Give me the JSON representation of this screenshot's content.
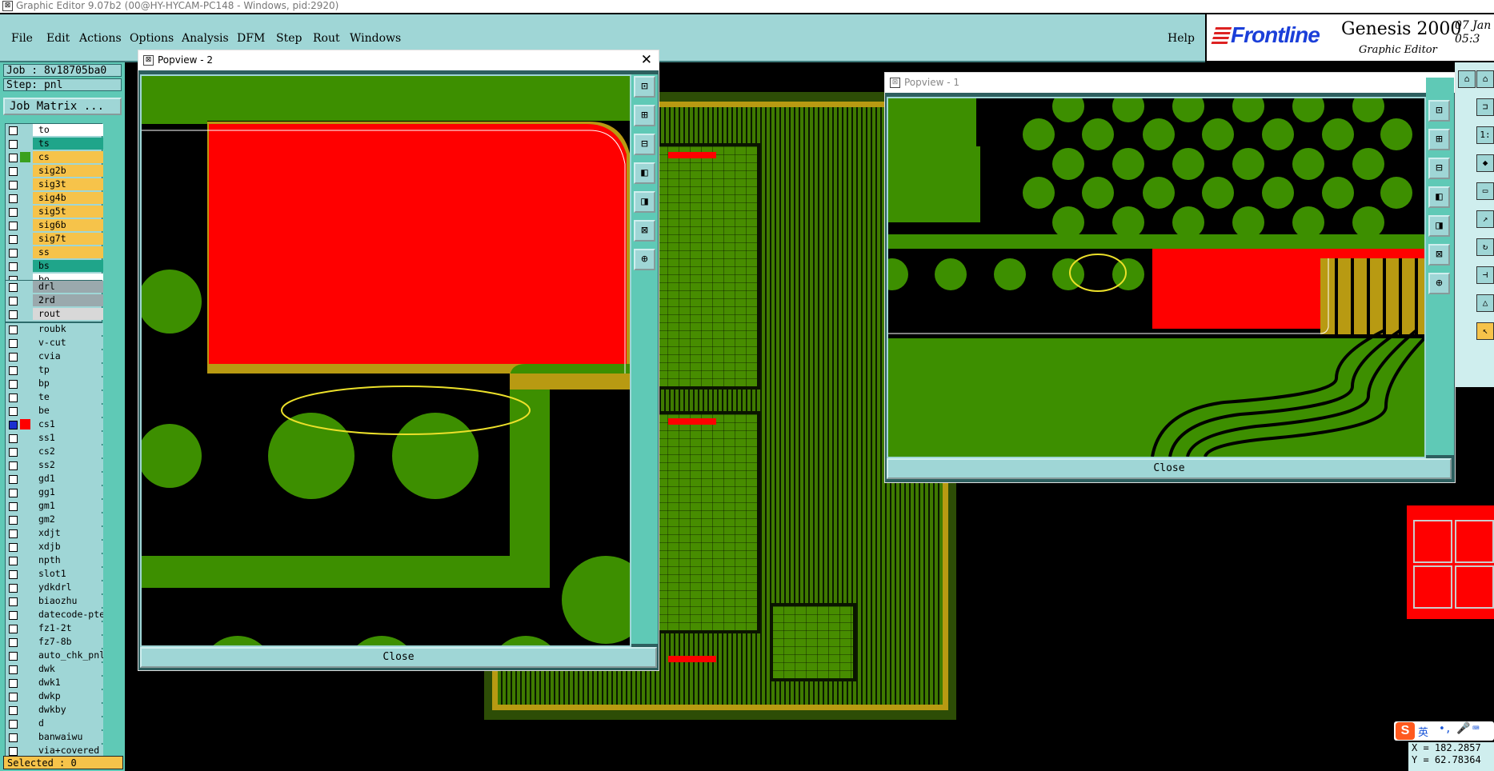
{
  "window": {
    "title": "Graphic Editor 9.07b2 (00@HY-HYCAM-PC148 - Windows, pid:2920)"
  },
  "menu": {
    "items": [
      "File",
      "Edit",
      "Actions",
      "Options",
      "Analysis",
      "DFM",
      "Step",
      "Rout",
      "Windows"
    ],
    "help": "Help"
  },
  "brand": {
    "logo_text": "Frontline",
    "product": "Genesis 2000",
    "subtitle": "Graphic Editor",
    "date_line1": "07 Jan",
    "date_line2": "05:3"
  },
  "job": {
    "job_line": "Job : 8v18705ba0",
    "step_line": "Step: pnl",
    "matrix_button": "Job Matrix ..."
  },
  "layers": {
    "group1": [
      {
        "name": "to",
        "color": "#ffffff",
        "swatch": "#9fd6d6"
      },
      {
        "name": "ts",
        "color": "#1fa58a",
        "swatch": "#9fd6d6"
      },
      {
        "name": "cs",
        "color": "#f6c34a",
        "swatch": "#3aa01e"
      },
      {
        "name": "sig2b",
        "color": "#f6c34a",
        "swatch": "#9fd6d6"
      },
      {
        "name": "sig3t",
        "color": "#f6c34a",
        "swatch": "#9fd6d6"
      },
      {
        "name": "sig4b",
        "color": "#f6c34a",
        "swatch": "#9fd6d6"
      },
      {
        "name": "sig5t",
        "color": "#f6c34a",
        "swatch": "#9fd6d6"
      },
      {
        "name": "sig6b",
        "color": "#f6c34a",
        "swatch": "#9fd6d6"
      },
      {
        "name": "sig7t",
        "color": "#f6c34a",
        "swatch": "#9fd6d6"
      },
      {
        "name": "ss",
        "color": "#f6c34a",
        "swatch": "#9fd6d6"
      },
      {
        "name": "bs",
        "color": "#1fa58a",
        "swatch": "#9fd6d6"
      },
      {
        "name": "bo",
        "color": "#ffffff",
        "swatch": "#9fd6d6"
      }
    ],
    "group2": [
      {
        "name": "drl",
        "color": "#9aa9ad",
        "swatch": "#9fd6d6"
      },
      {
        "name": "2rd",
        "color": "#9aa9ad",
        "swatch": "#9fd6d6"
      },
      {
        "name": "rout",
        "color": "#d8d8d8",
        "swatch": "#9fd6d6"
      }
    ],
    "group3": [
      {
        "name": "roubk",
        "color": "#9fd6d6",
        "swatch": "#9fd6d6"
      },
      {
        "name": "v-cut",
        "color": "#9fd6d6",
        "swatch": "#9fd6d6"
      },
      {
        "name": "cvia",
        "color": "#9fd6d6",
        "swatch": "#9fd6d6"
      },
      {
        "name": "tp",
        "color": "#9fd6d6",
        "swatch": "#9fd6d6"
      },
      {
        "name": "bp",
        "color": "#9fd6d6",
        "swatch": "#9fd6d6"
      },
      {
        "name": "te",
        "color": "#9fd6d6",
        "swatch": "#9fd6d6"
      },
      {
        "name": "be",
        "color": "#9fd6d6",
        "swatch": "#9fd6d6"
      },
      {
        "name": "cs1",
        "color": "#9fd6d6",
        "swatch": "#ff0000",
        "checkbox": "#1b2fd0"
      },
      {
        "name": "ss1",
        "color": "#9fd6d6",
        "swatch": "#9fd6d6"
      },
      {
        "name": "cs2",
        "color": "#9fd6d6",
        "swatch": "#9fd6d6"
      },
      {
        "name": "ss2",
        "color": "#9fd6d6",
        "swatch": "#9fd6d6"
      },
      {
        "name": "gd1",
        "color": "#9fd6d6",
        "swatch": "#9fd6d6"
      },
      {
        "name": "gg1",
        "color": "#9fd6d6",
        "swatch": "#9fd6d6"
      },
      {
        "name": "gm1",
        "color": "#9fd6d6",
        "swatch": "#9fd6d6"
      },
      {
        "name": "gm2",
        "color": "#9fd6d6",
        "swatch": "#9fd6d6"
      },
      {
        "name": "xdjt",
        "color": "#9fd6d6",
        "swatch": "#9fd6d6"
      },
      {
        "name": "xdjb",
        "color": "#9fd6d6",
        "swatch": "#9fd6d6"
      },
      {
        "name": "npth",
        "color": "#9fd6d6",
        "swatch": "#9fd6d6"
      },
      {
        "name": "slot1",
        "color": "#9fd6d6",
        "swatch": "#9fd6d6"
      },
      {
        "name": "ydkdrl",
        "color": "#9fd6d6",
        "swatch": "#9fd6d6"
      },
      {
        "name": "biaozhu",
        "color": "#9fd6d6",
        "swatch": "#9fd6d6"
      },
      {
        "name": "datecode-pte",
        "color": "#9fd6d6",
        "swatch": "#9fd6d6"
      },
      {
        "name": "fz1-2t",
        "color": "#9fd6d6",
        "swatch": "#9fd6d6"
      },
      {
        "name": "fz7-8b",
        "color": "#9fd6d6",
        "swatch": "#9fd6d6"
      },
      {
        "name": "auto_chk_pnl",
        "color": "#9fd6d6",
        "swatch": "#9fd6d6"
      },
      {
        "name": "dwk",
        "color": "#9fd6d6",
        "swatch": "#9fd6d6"
      },
      {
        "name": "dwk1",
        "color": "#9fd6d6",
        "swatch": "#9fd6d6"
      },
      {
        "name": "dwkp",
        "color": "#9fd6d6",
        "swatch": "#9fd6d6"
      },
      {
        "name": "dwkby",
        "color": "#9fd6d6",
        "swatch": "#9fd6d6"
      },
      {
        "name": "d",
        "color": "#9fd6d6",
        "swatch": "#9fd6d6"
      },
      {
        "name": "banwaiwu",
        "color": "#9fd6d6",
        "swatch": "#9fd6d6"
      },
      {
        "name": "via+covered",
        "color": "#9fd6d6",
        "swatch": "#9fd6d6"
      }
    ]
  },
  "status": {
    "selected": "Selected : 0"
  },
  "popview2": {
    "title": "Popview - 2",
    "close_label": "Close"
  },
  "popview1": {
    "title": "Popview - 1",
    "close_label": "Close"
  },
  "coords": {
    "x": "X = 182.2857",
    "y": "Y = 62.78364"
  },
  "ime": {
    "label": "英"
  },
  "colors": {
    "copper": "#3d8f00",
    "highlight": "#ff0000",
    "annotation": "#e8e010",
    "gold": "#b89a12",
    "panel": "#9fd6d6"
  }
}
